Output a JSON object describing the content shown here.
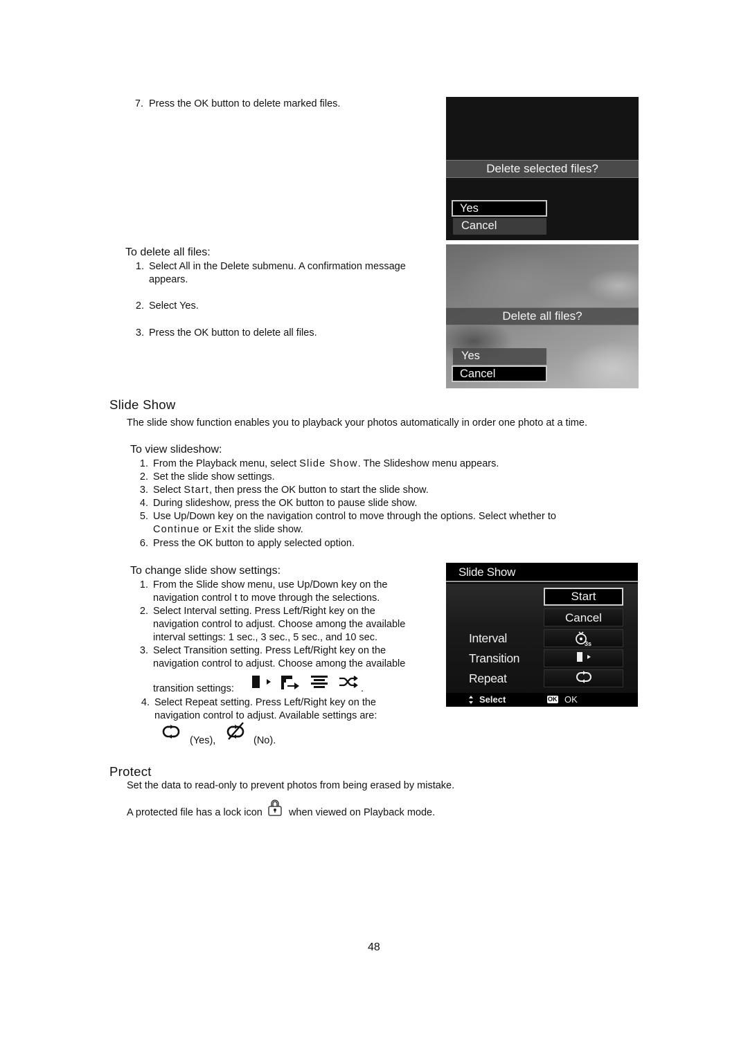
{
  "top_step": {
    "num": "7.",
    "text": "Press the OK button to delete marked files."
  },
  "screen_delete_selected": {
    "prompt": "Delete selected files?",
    "options": [
      {
        "label": "Yes",
        "selected": true
      },
      {
        "label": "Cancel",
        "selected": false
      }
    ]
  },
  "delete_all": {
    "heading": "To delete all files:",
    "steps": [
      {
        "num": "1.",
        "line1": "Select All in the Delete submenu. A confirmation message",
        "line2": "appears."
      },
      {
        "num": "2.",
        "line1": "Select Yes."
      },
      {
        "num": "3.",
        "line1": "Press the OK button to delete all files."
      }
    ]
  },
  "screen_delete_all": {
    "prompt": "Delete all files?",
    "options": [
      {
        "label": "Yes",
        "selected": false
      },
      {
        "label": "Cancel",
        "selected": true
      }
    ]
  },
  "slideshow": {
    "title": "Slide Show",
    "intro": "The slide show function enables you to playback your photos automatically in order one photo at a time.",
    "view_heading": "To view slideshow:",
    "view_steps": [
      {
        "num": "1.",
        "pre": "From the Playback menu, select ",
        "term": "Slide Show",
        "post": ". The Slideshow menu appears."
      },
      {
        "num": "2.",
        "pre": "Set the slide show settings."
      },
      {
        "num": "3.",
        "pre": "Select ",
        "term": "Start",
        "post": ", then press the OK button to start the slide show."
      },
      {
        "num": "4.",
        "pre": "During slideshow, press the OK button to pause slide show."
      },
      {
        "num": "5.",
        "pre": "Use Up/Down key on the navigation control to move through the options. Select whether to",
        "line2_term1": "Continue",
        "line2_mid": " or ",
        "line2_term2": "Exit",
        "line2_post": " the slide show."
      },
      {
        "num": "6.",
        "pre": "Press the OK button to apply selected option."
      }
    ],
    "change_heading": "To change slide show settings:",
    "change_steps": [
      {
        "num": "1.",
        "lines": [
          "From the Slide show menu, use Up/Down key on the",
          "navigation control t to move through the selections."
        ]
      },
      {
        "num": "2.",
        "lines": [
          "Select Interval setting. Press Left/Right key on the",
          "navigation control to adjust. Choose among the available",
          "interval settings: 1 sec., 3 sec., 5 sec., and 10 sec."
        ]
      },
      {
        "num": "3.",
        "lines": [
          "Select Transition setting. Press Left/Right key on the",
          "navigation control to adjust. Choose among the available"
        ],
        "icons_prefix": "transition settings:",
        "icons": [
          "transition-slide-icon",
          "transition-corner-icon",
          "transition-blinds-icon",
          "transition-random-icon"
        ],
        "icons_suffix": "."
      },
      {
        "num": "4.",
        "lines": [
          "Select Repeat setting. Press Left/Right key on the",
          "navigation control to adjust. Available settings are:"
        ],
        "repeat_yes": "(Yes),",
        "repeat_no": "(No)."
      }
    ]
  },
  "screen_slideshow": {
    "title": "Slide Show",
    "buttons": [
      {
        "label": "Start",
        "selected": true
      },
      {
        "label": "Cancel",
        "selected": false
      }
    ],
    "settings": [
      {
        "label": "Interval",
        "value_icon": "interval-timer-icon",
        "value_text": "3s"
      },
      {
        "label": "Transition",
        "value_icon": "transition-slide-icon"
      },
      {
        "label": "Repeat",
        "value_icon": "repeat-icon"
      }
    ],
    "footer": {
      "select_label": "Select",
      "ok_badge": "OK",
      "ok_label": "OK"
    }
  },
  "protect": {
    "title": "Protect",
    "line1": "Set the data to read-only to prevent photos from being erased by mistake.",
    "line2_pre": "A protected file has a lock icon",
    "line2_post": "when viewed on Playback mode."
  },
  "page_number": "48"
}
